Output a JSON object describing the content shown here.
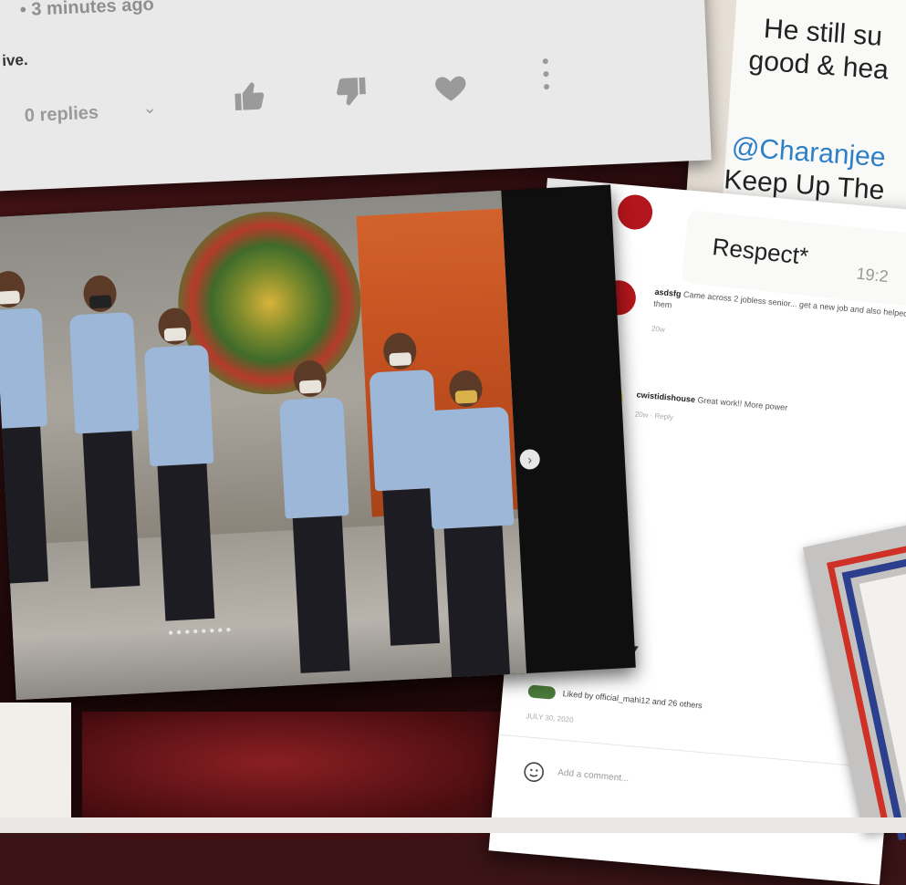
{
  "youtube_comment": {
    "timestamp": "• 3 minutes ago",
    "text_fragment": "ive.",
    "replies_label": "0 replies",
    "icons": [
      "thumbs-up-icon",
      "thumbs-down-icon",
      "heart-icon",
      "more-vertical-icon"
    ]
  },
  "photo": {
    "carousel_dots": "●●●●●●●●",
    "next_arrow": "›"
  },
  "chat": {
    "line1": "He still su",
    "line2": "good & hea",
    "mention": "@Charanjee",
    "line3": "Keep Up The",
    "respect_text": "Respect*",
    "respect_time": "19:2"
  },
  "instagram": {
    "comment1_user": "asdsfg",
    "comment1_text": "Came across 2 jobless senior... get a new job and also helped them",
    "comment1_meta": "20w",
    "comment2_user": "cwistidishouse",
    "comment2_text": "Great work!! More power",
    "comment2_meta": "20w · Reply",
    "liked_by": "Liked by official_mahi12 and 26 others",
    "date": "JULY 30, 2020",
    "add_comment": "Add a comment...",
    "icons": [
      "heart-icon",
      "comment-icon",
      "share-icon",
      "emoji-icon"
    ]
  },
  "colors": {
    "instagram_avatar_red": "#b3161c",
    "instagram_avatar_yellow": "#f4e01e",
    "mention_blue": "#2d7fc8",
    "poster_red": "#cf3126",
    "poster_blue": "#2c3f8f"
  }
}
